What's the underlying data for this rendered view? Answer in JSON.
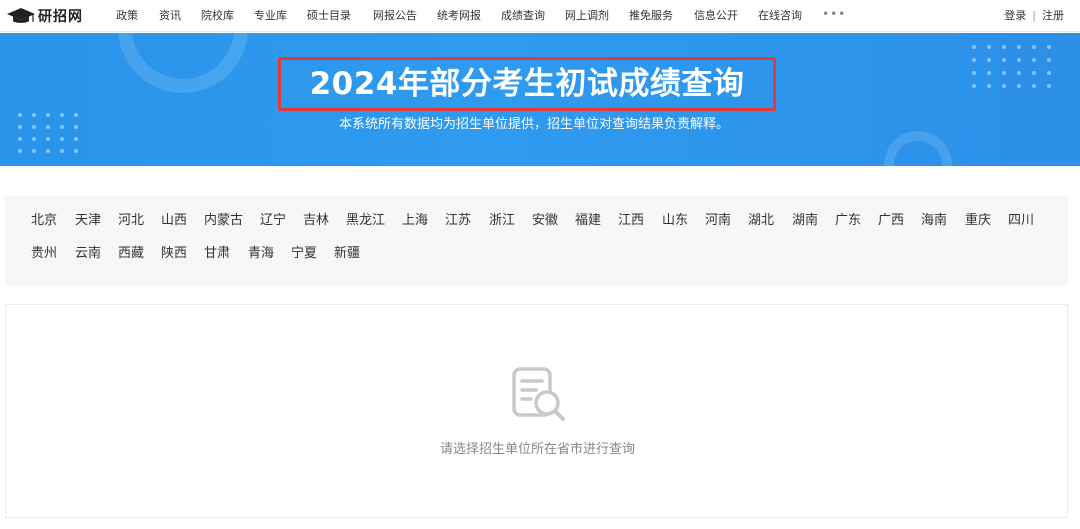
{
  "header": {
    "logo_text": "研招网",
    "nav": [
      "政策",
      "资讯",
      "院校库",
      "专业库",
      "硕士目录",
      "网报公告",
      "统考网报",
      "成绩查询",
      "网上调剂",
      "推免服务",
      "信息公开",
      "在线咨询"
    ],
    "more": "•••",
    "login": "登录",
    "separator": "|",
    "register": "注册"
  },
  "banner": {
    "title": "2024年部分考生初试成绩查询",
    "subtitle": "本系统所有数据均为招生单位提供，招生单位对查询结果负责解释。"
  },
  "provinces": [
    "北京",
    "天津",
    "河北",
    "山西",
    "内蒙古",
    "辽宁",
    "吉林",
    "黑龙江",
    "上海",
    "江苏",
    "浙江",
    "安徽",
    "福建",
    "江西",
    "山东",
    "河南",
    "湖北",
    "湖南",
    "广东",
    "广西",
    "海南",
    "重庆",
    "四川",
    "贵州",
    "云南",
    "西藏",
    "陕西",
    "甘肃",
    "青海",
    "宁夏",
    "新疆"
  ],
  "result": {
    "icon": "document-search-icon",
    "empty_text": "请选择招生单位所在省市进行查询"
  },
  "colors": {
    "banner_blue": "#2e9bf0",
    "title_outline": "#e53935",
    "panel_bg": "#f6f7f9"
  }
}
